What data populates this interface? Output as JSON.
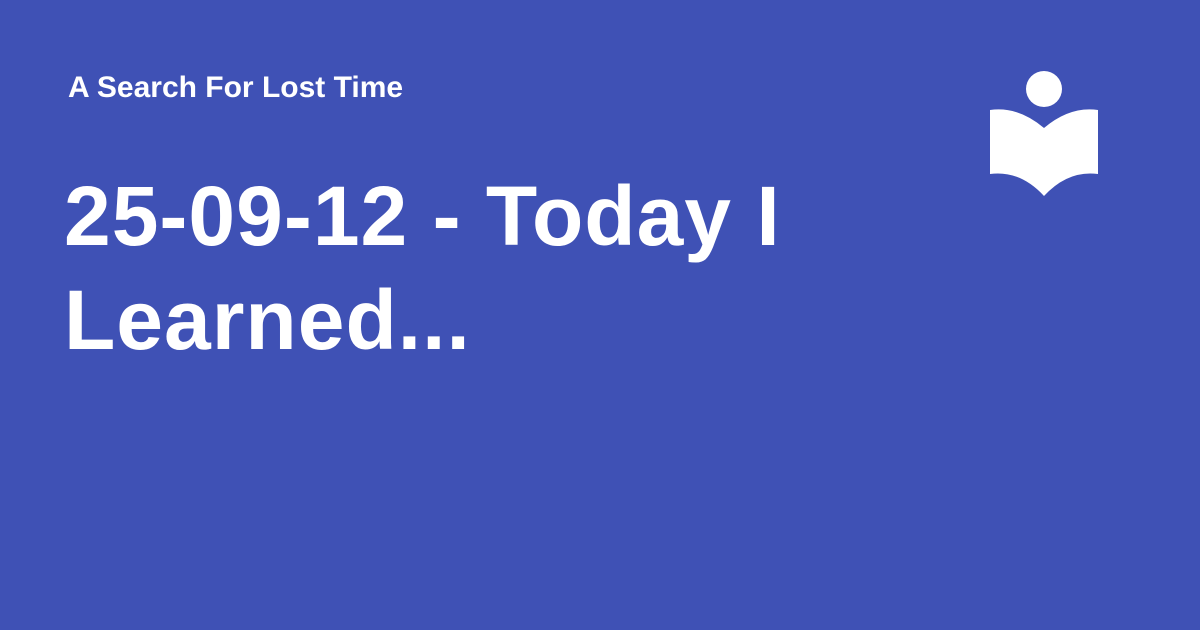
{
  "card": {
    "site_name": "A Search For Lost Time",
    "title": "25-09-12 - Today I Learned...",
    "logo_icon": "book-reader-icon"
  },
  "colors": {
    "background": "#3f51b5",
    "text": "#ffffff"
  }
}
